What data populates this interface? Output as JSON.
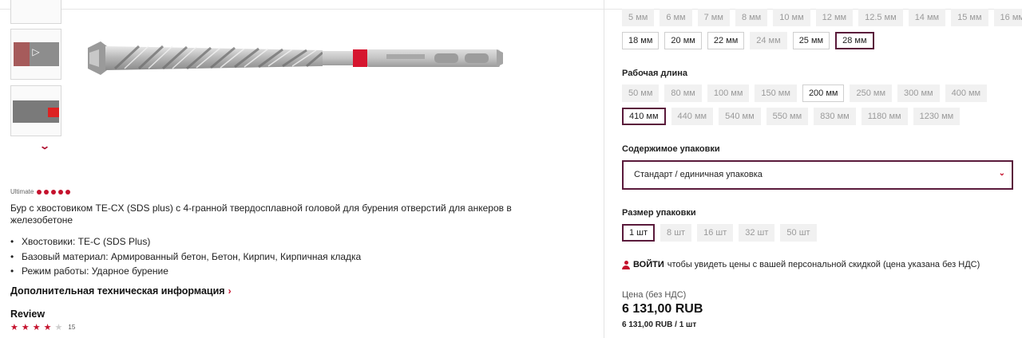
{
  "gallery": {
    "thumbnails": [
      {
        "kind": "image"
      },
      {
        "kind": "video",
        "icon": "play-icon"
      },
      {
        "kind": "image"
      }
    ],
    "scroll_icon": "chevron-down-icon"
  },
  "product": {
    "tier": "Ultimate",
    "tier_dots": 5,
    "description": "Бур с хвостовиком TE-CX (SDS plus) с 4-гранной твердосплавной головой для бурения отверстий для анкеров в железобетоне",
    "bullets": [
      "Хвостовики: TE-C (SDS Plus)",
      "Базовый материал: Армированный бетон, Бетон, Кирпич, Кирпичная кладка",
      "Режим работы: Ударное бурение"
    ],
    "more_info": "Дополнительная техническая информация",
    "review_title": "Review",
    "rating": 4,
    "rating_max": 5,
    "review_count": "15"
  },
  "diameter": {
    "row1": [
      {
        "label": "5 мм",
        "state": "unavailable"
      },
      {
        "label": "6 мм",
        "state": "unavailable"
      },
      {
        "label": "7 мм",
        "state": "unavailable"
      },
      {
        "label": "8 мм",
        "state": "unavailable"
      },
      {
        "label": "10 мм",
        "state": "unavailable"
      },
      {
        "label": "12 мм",
        "state": "unavailable"
      },
      {
        "label": "12.5 мм",
        "state": "unavailable"
      },
      {
        "label": "14 мм",
        "state": "unavailable"
      },
      {
        "label": "15 мм",
        "state": "unavailable"
      },
      {
        "label": "16 мм",
        "state": "unavailable"
      }
    ],
    "row2": [
      {
        "label": "18 мм",
        "state": "available"
      },
      {
        "label": "20 мм",
        "state": "available"
      },
      {
        "label": "22 мм",
        "state": "available"
      },
      {
        "label": "24 мм",
        "state": "unavailable"
      },
      {
        "label": "25 мм",
        "state": "available"
      },
      {
        "label": "28 мм",
        "state": "selected"
      }
    ]
  },
  "working_length": {
    "title": "Рабочая длина",
    "row1": [
      {
        "label": "50 мм",
        "state": "unavailable"
      },
      {
        "label": "80 мм",
        "state": "unavailable"
      },
      {
        "label": "100 мм",
        "state": "unavailable"
      },
      {
        "label": "150 мм",
        "state": "unavailable"
      },
      {
        "label": "200 мм",
        "state": "available"
      },
      {
        "label": "250 мм",
        "state": "unavailable"
      },
      {
        "label": "300 мм",
        "state": "unavailable"
      },
      {
        "label": "400 мм",
        "state": "unavailable"
      }
    ],
    "row2": [
      {
        "label": "410 мм",
        "state": "selected"
      },
      {
        "label": "440 мм",
        "state": "unavailable"
      },
      {
        "label": "540 мм",
        "state": "unavailable"
      },
      {
        "label": "550 мм",
        "state": "unavailable"
      },
      {
        "label": "830 мм",
        "state": "unavailable"
      },
      {
        "label": "1180 мм",
        "state": "unavailable"
      },
      {
        "label": "1230 мм",
        "state": "unavailable"
      }
    ]
  },
  "package_content": {
    "title": "Содержимое упаковки",
    "selected": "Стандарт / единичная упаковка"
  },
  "package_size": {
    "title": "Размер упаковки",
    "options": [
      {
        "label": "1 шт",
        "state": "selected"
      },
      {
        "label": "8 шт",
        "state": "unavailable"
      },
      {
        "label": "16 шт",
        "state": "unavailable"
      },
      {
        "label": "32 шт",
        "state": "unavailable"
      },
      {
        "label": "50 шт",
        "state": "unavailable"
      }
    ]
  },
  "login": {
    "link": "ВОЙТИ",
    "text": "чтобы увидеть цены с вашей персональной скидкой (цена указана без НДС)"
  },
  "price": {
    "label": "Цена (без НДС)",
    "value": "6 131,00 RUB",
    "per_unit": "6 131,00 RUB / 1 шт"
  },
  "colors": {
    "accent": "#c5122d",
    "selected_border": "#5a1a3b"
  }
}
